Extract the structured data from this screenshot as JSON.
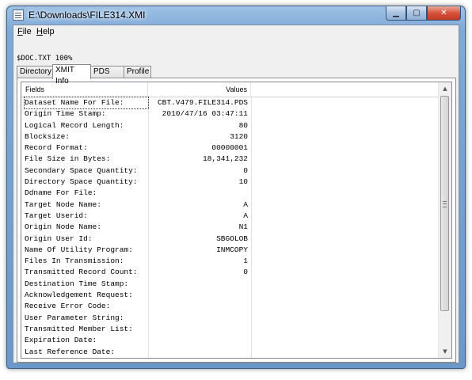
{
  "window": {
    "title": "E:\\Downloads\\FILE314.XMI"
  },
  "menu": {
    "file": "File",
    "help": "Help"
  },
  "status": "$DOC.TXT 100%",
  "tabs": [
    {
      "label": "Directory"
    },
    {
      "label": "XMIT Info"
    },
    {
      "label": "PDS Info"
    },
    {
      "label": "Profile"
    }
  ],
  "list": {
    "headers": {
      "fields": "Fields",
      "values": "Values"
    },
    "rows": [
      {
        "field": "Dataset Name For File:",
        "value": "CBT.V479.FILE314.PDS"
      },
      {
        "field": "Origin Time Stamp:",
        "value": "2010/47/16 03:47:11"
      },
      {
        "field": "Logical Record Length:",
        "value": "80"
      },
      {
        "field": "Blocksize:",
        "value": "3120"
      },
      {
        "field": "Record Format:",
        "value": "00000001"
      },
      {
        "field": "File Size in Bytes:",
        "value": "18,341,232"
      },
      {
        "field": "Secondary Space Quantity:",
        "value": "0"
      },
      {
        "field": "Directory Space Quantity:",
        "value": "10"
      },
      {
        "field": "Ddname For File:",
        "value": ""
      },
      {
        "field": "Target Node Name:",
        "value": "A"
      },
      {
        "field": "Target Userid:",
        "value": "A"
      },
      {
        "field": "Origin Node Name:",
        "value": "N1"
      },
      {
        "field": "Origin User Id:",
        "value": "SBGOLOB"
      },
      {
        "field": "Name Of Utility Program:",
        "value": "INMCOPY"
      },
      {
        "field": "Files In Transmission:",
        "value": "1"
      },
      {
        "field": "Transmitted Record Count:",
        "value": "0"
      },
      {
        "field": "Destination Time Stamp:",
        "value": ""
      },
      {
        "field": "Acknowledgement Request:",
        "value": ""
      },
      {
        "field": "Receive Error Code:",
        "value": ""
      },
      {
        "field": "User Parameter String:",
        "value": ""
      },
      {
        "field": "Transmitted Member List:",
        "value": ""
      },
      {
        "field": "Expiration Date:",
        "value": ""
      },
      {
        "field": "Last Reference Date:",
        "value": ""
      }
    ]
  },
  "icons": {
    "minimize": "minimize-icon",
    "maximize": "maximize-icon",
    "close": "close-icon",
    "scroll_up": "scroll-up-arrow-icon",
    "scroll_down": "scroll-down-arrow-icon"
  }
}
